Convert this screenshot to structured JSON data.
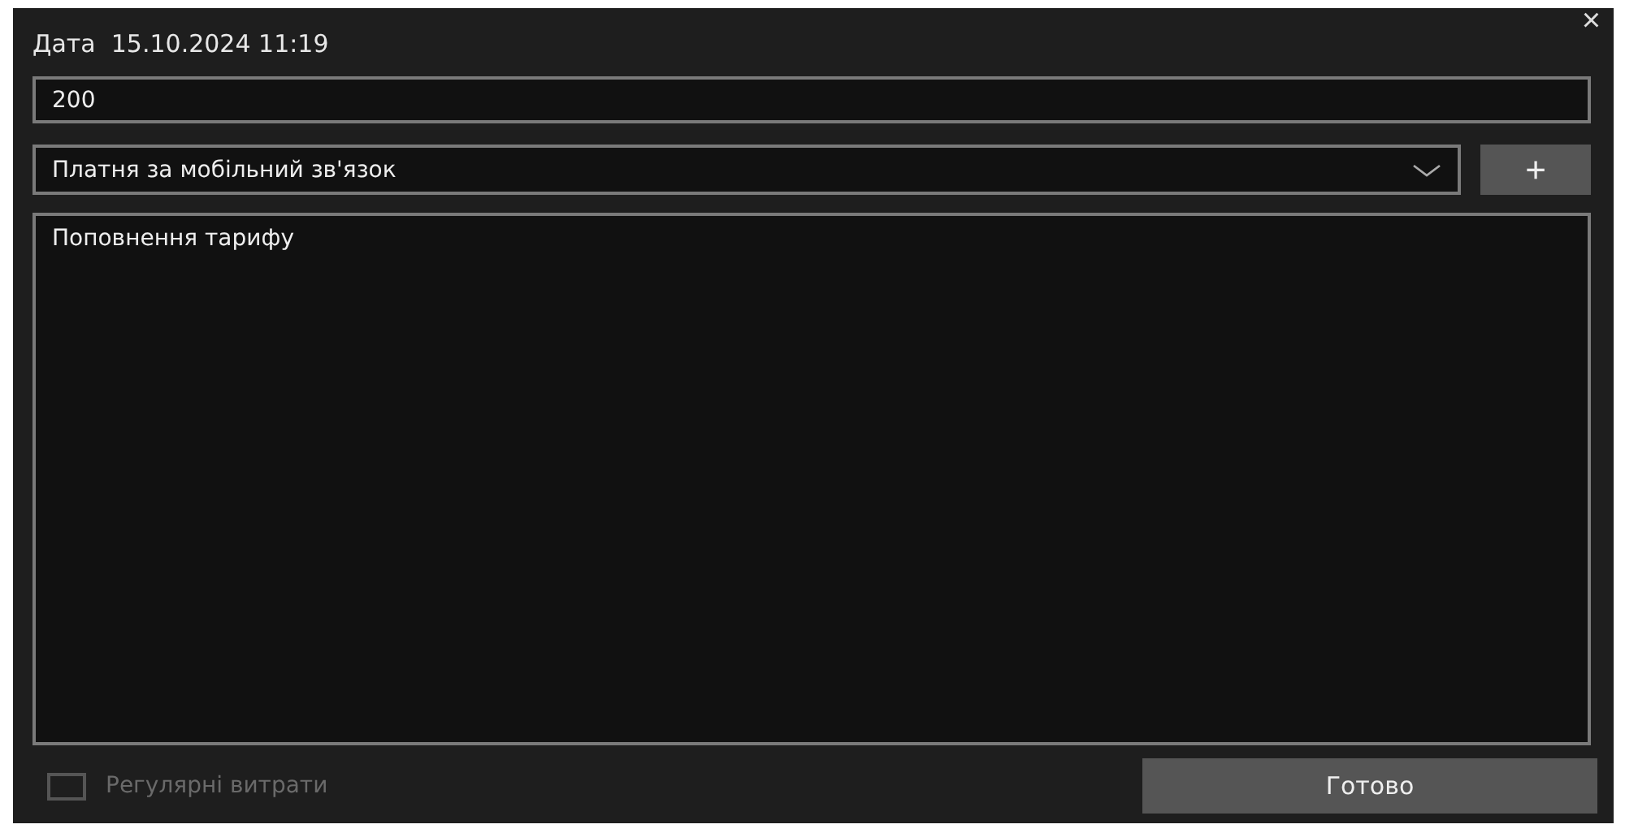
{
  "title": {
    "label": "Дата",
    "value": "15.10.2024 11:19"
  },
  "close_button": "×",
  "amount": {
    "value": "200"
  },
  "category": {
    "value": "Платня за мобільний зв'язок"
  },
  "add_button": "+",
  "note": {
    "value": "Поповнення тарифу"
  },
  "recurring": {
    "label": "Регулярні витрати",
    "checked": false,
    "disabled": true
  },
  "done_button": "Готово"
}
